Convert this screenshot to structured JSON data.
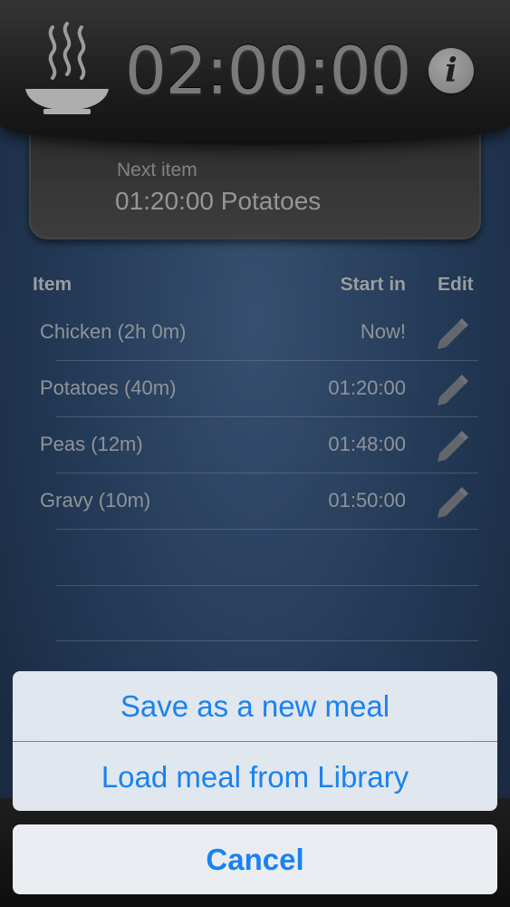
{
  "header": {
    "timer": "02:00:00",
    "info_icon": "info-icon",
    "app_icon": "steaming-bowl-icon"
  },
  "next_item": {
    "label": "Next item",
    "value": "01:20:00 Potatoes"
  },
  "table": {
    "headers": {
      "item": "Item",
      "start_in": "Start in",
      "edit": "Edit"
    },
    "rows": [
      {
        "name": "Chicken (2h 0m)",
        "start_in": "Now!"
      },
      {
        "name": "Potatoes (40m)",
        "start_in": "01:20:00"
      },
      {
        "name": "Peas (12m)",
        "start_in": "01:48:00"
      },
      {
        "name": "Gravy (10m)",
        "start_in": "01:50:00"
      }
    ],
    "edit_icon": "pencil-icon"
  },
  "action_sheet": {
    "save_label": "Save as a new meal",
    "load_label": "Load meal from Library",
    "cancel_label": "Cancel"
  },
  "colors": {
    "accent": "#1a82ef",
    "background": "#34547d",
    "header": "#2b2b2b"
  }
}
